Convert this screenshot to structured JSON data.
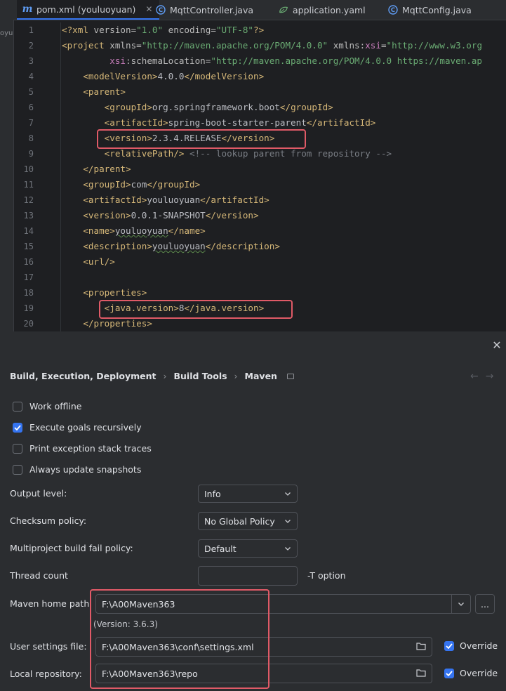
{
  "editor": {
    "tabs": [
      {
        "label": "pom.xml (youluoyuan)",
        "icon": "maven-icon",
        "active": true
      },
      {
        "label": "MqttController.java",
        "icon": "java-class-icon",
        "active": false
      },
      {
        "label": "application.yaml",
        "icon": "yaml-leaf-icon",
        "active": false
      },
      {
        "label": "MqttConfig.java",
        "icon": "java-class-icon",
        "active": false
      }
    ],
    "project_strip": "oyu",
    "line_numbers": [
      "1",
      "2",
      "3",
      "4",
      "5",
      "6",
      "7",
      "8",
      "9",
      "10",
      "11",
      "12",
      "13",
      "14",
      "15",
      "16",
      "17",
      "18",
      "19",
      "20"
    ],
    "lines": [
      {
        "indent": "",
        "segs": [
          [
            "tg",
            "<?xml "
          ],
          [
            "an",
            "version="
          ],
          [
            "av",
            "\"1.0\""
          ],
          [
            "an",
            " encoding="
          ],
          [
            "av",
            "\"UTF-8\""
          ],
          [
            "tg",
            "?>"
          ]
        ]
      },
      {
        "indent": "",
        "segs": [
          [
            "tg",
            "<project "
          ],
          [
            "an",
            "xmlns="
          ],
          [
            "av",
            "\"http://maven.apache.org/POM/4.0.0\""
          ],
          [
            "an",
            " xmlns:"
          ],
          [
            "ns",
            "xsi"
          ],
          [
            "an",
            "="
          ],
          [
            "av",
            "\"http://www.w3.org"
          ]
        ]
      },
      {
        "indent": "         ",
        "segs": [
          [
            "ns",
            "xsi"
          ],
          [
            "an",
            ":schemaLocation="
          ],
          [
            "av",
            "\"http://maven.apache.org/POM/4.0.0 https://maven.ap"
          ]
        ]
      },
      {
        "indent": "    ",
        "segs": [
          [
            "tg",
            "<modelVersion>"
          ],
          [
            "tx",
            "4.0.0"
          ],
          [
            "tg",
            "</modelVersion>"
          ]
        ]
      },
      {
        "indent": "    ",
        "segs": [
          [
            "tg",
            "<parent>"
          ]
        ]
      },
      {
        "indent": "        ",
        "segs": [
          [
            "tg",
            "<groupId>"
          ],
          [
            "tx",
            "org.springframework.boot"
          ],
          [
            "tg",
            "</groupId>"
          ]
        ]
      },
      {
        "indent": "        ",
        "segs": [
          [
            "tg",
            "<artifactId>"
          ],
          [
            "tx",
            "spring-boot-starter-parent"
          ],
          [
            "tg",
            "</artifactId>"
          ]
        ]
      },
      {
        "indent": "        ",
        "segs": [
          [
            "tg",
            "<version>"
          ],
          [
            "tx",
            "2.3.4.RELEASE"
          ],
          [
            "tg",
            "</version>"
          ]
        ]
      },
      {
        "indent": "        ",
        "segs": [
          [
            "tg",
            "<relativePath/>"
          ],
          [
            "tx",
            " "
          ],
          [
            "cm",
            "<!-- lookup parent from repository -->"
          ]
        ]
      },
      {
        "indent": "    ",
        "segs": [
          [
            "tg",
            "</parent>"
          ]
        ]
      },
      {
        "indent": "    ",
        "segs": [
          [
            "tg",
            "<groupId>"
          ],
          [
            "tx",
            "com"
          ],
          [
            "tg",
            "</groupId>"
          ]
        ]
      },
      {
        "indent": "    ",
        "segs": [
          [
            "tg",
            "<artifactId>"
          ],
          [
            "tx",
            "youluoyuan"
          ],
          [
            "tg",
            "</artifactId>"
          ]
        ]
      },
      {
        "indent": "    ",
        "segs": [
          [
            "tg",
            "<version>"
          ],
          [
            "tx",
            "0.0.1-SNAPSHOT"
          ],
          [
            "tg",
            "</version>"
          ]
        ]
      },
      {
        "indent": "    ",
        "segs": [
          [
            "tg",
            "<name>"
          ],
          [
            "uw",
            "youluoyuan"
          ],
          [
            "tg",
            "</name>"
          ]
        ]
      },
      {
        "indent": "    ",
        "segs": [
          [
            "tg",
            "<description>"
          ],
          [
            "uw",
            "youluoyuan"
          ],
          [
            "tg",
            "</description>"
          ]
        ]
      },
      {
        "indent": "    ",
        "segs": [
          [
            "tg",
            "<url/>"
          ]
        ]
      },
      {
        "indent": "",
        "segs": []
      },
      {
        "indent": "    ",
        "segs": [
          [
            "tg",
            "<properties>"
          ]
        ]
      },
      {
        "indent": "        ",
        "segs": [
          [
            "tg",
            "<java.version>"
          ],
          [
            "tx",
            "8"
          ],
          [
            "tg",
            "</java.version>"
          ]
        ]
      },
      {
        "indent": "    ",
        "segs": [
          [
            "tg",
            "</properties>"
          ]
        ]
      }
    ]
  },
  "settings": {
    "breadcrumb": [
      "Build, Execution, Deployment",
      "Build Tools",
      "Maven"
    ],
    "checkboxes": [
      {
        "label": "Work offline",
        "checked": false
      },
      {
        "label": "Execute goals recursively",
        "checked": true
      },
      {
        "label": "Print exception stack traces",
        "checked": false
      },
      {
        "label": "Always update snapshots",
        "checked": false
      }
    ],
    "output_level": {
      "label": "Output level:",
      "value": "Info"
    },
    "checksum_policy": {
      "label": "Checksum policy:",
      "value": "No Global Policy"
    },
    "fail_policy": {
      "label": "Multiproject build fail policy:",
      "value": "Default"
    },
    "thread_count": {
      "label": "Thread count",
      "value": "",
      "suffix": "-T option"
    },
    "maven_home": {
      "label": "Maven home path:",
      "value": "F:\\A00Maven363",
      "version": "(Version: 3.6.3)",
      "browse": "..."
    },
    "user_settings": {
      "label": "User settings file:",
      "value": "F:\\A00Maven363\\conf\\settings.xml",
      "override": "Override"
    },
    "local_repo": {
      "label": "Local repository:",
      "value": "F:\\A00Maven363\\repo",
      "override": "Override"
    },
    "colors": {
      "accent": "#3574f0",
      "highlight": "#e05a67"
    }
  }
}
